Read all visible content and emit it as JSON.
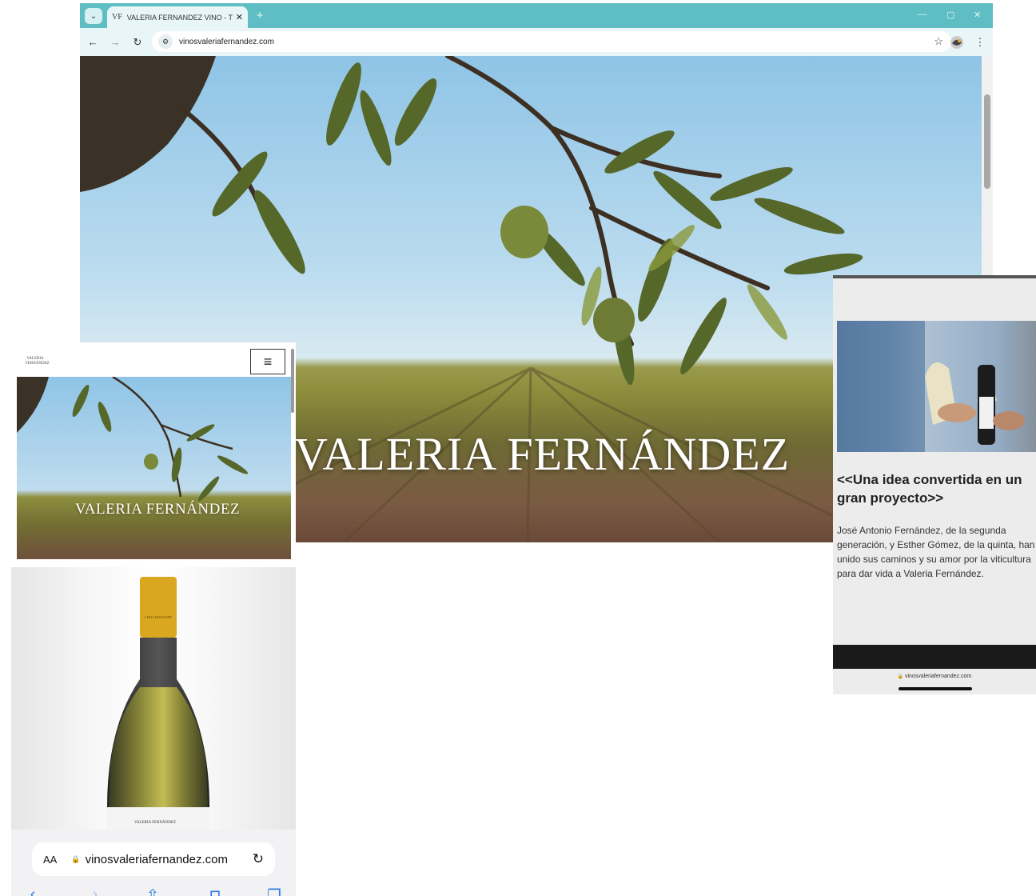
{
  "desktop": {
    "tab": {
      "favicon": "VF",
      "title": "VALERIA FERNANDEZ VINO - T",
      "close": "✕"
    },
    "new_tab": "+",
    "window_controls": {
      "minimize": "—",
      "restore": "▢",
      "close": "✕"
    },
    "nav": {
      "back": "←",
      "forward": "→",
      "reload": "↻"
    },
    "url": "vinosvaleriafernandez.com",
    "bookmark_icon": "☆",
    "menu_icon": "⋮",
    "hero_title": "VALERIA FERNÁNDEZ"
  },
  "mobile_left": {
    "logo_text": "VALERIA FERNÁNDEZ",
    "menu_icon": "≡",
    "hero_title": "VALERIA FERNÁNDEZ",
    "bottle_label": "VALERIA FERNÁNDEZ",
    "bottle_capsule_text": "LERIA FERNANDE",
    "safari": {
      "text_size": "AA",
      "url": "vinosvaleriafernandez.com",
      "reload": "↻"
    }
  },
  "mobile_right": {
    "heading": "<<Una idea convertida en un gran proyecto>>",
    "body": "José Antonio Fernández, de la segunda generación, y Esther Gómez, de la quinta, han unido sus caminos y su amor por la viticultura para dar vida a Valeria Fernández.",
    "url": "vinosvaleriafernandez.com"
  },
  "colors": {
    "tab_bar": "#5fbec4",
    "toolbar": "#e8f6f7",
    "safari_accent": "#2f7de1"
  }
}
